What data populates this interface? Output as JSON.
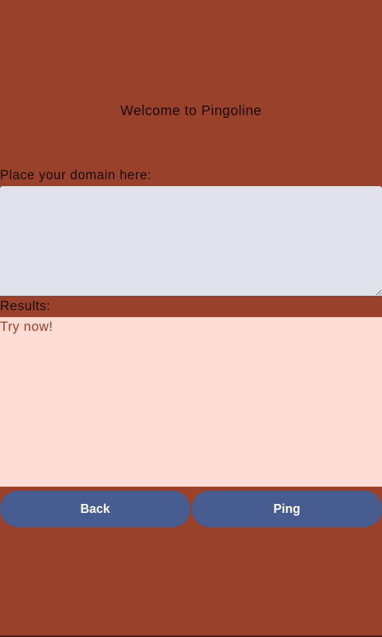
{
  "header": {
    "title": "Welcome to Pingoline"
  },
  "domain": {
    "label": "Place your domain here:",
    "value": "",
    "placeholder": ""
  },
  "results": {
    "label": "Results:",
    "text": "Try now!"
  },
  "actions": {
    "back_label": "Back",
    "ping_label": "Ping"
  },
  "colors": {
    "background": "#99412a",
    "input_background": "#e2e2ed",
    "results_background": "#ffddd4",
    "results_text": "#a33c22",
    "button": "#475d92"
  }
}
